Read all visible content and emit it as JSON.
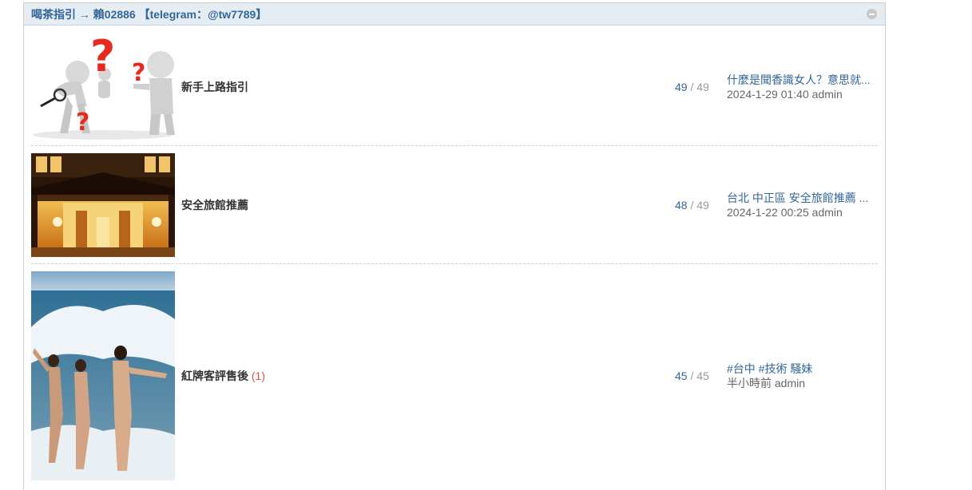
{
  "header": {
    "title": "喝茶指引 → 賴02886 【telegram：@tw7789】"
  },
  "forums": [
    {
      "name": "新手上路指引",
      "today": "",
      "threads": "49",
      "posts": "49",
      "last_title": "什麼是聞香識女人？意思就...",
      "last_time": "2024-1-29 01:40",
      "last_author": "admin"
    },
    {
      "name": "安全旅館推薦",
      "today": "",
      "threads": "48",
      "posts": "49",
      "last_title": "台北 中正區 安全旅館推薦 ...",
      "last_time": "2024-1-22 00:25",
      "last_author": "admin"
    },
    {
      "name": "紅牌客評售後",
      "today": "(1)",
      "threads": "45",
      "posts": "45",
      "last_title": "#台中 #技術 騷妹",
      "last_time": "半小時前",
      "last_author": "admin"
    }
  ]
}
